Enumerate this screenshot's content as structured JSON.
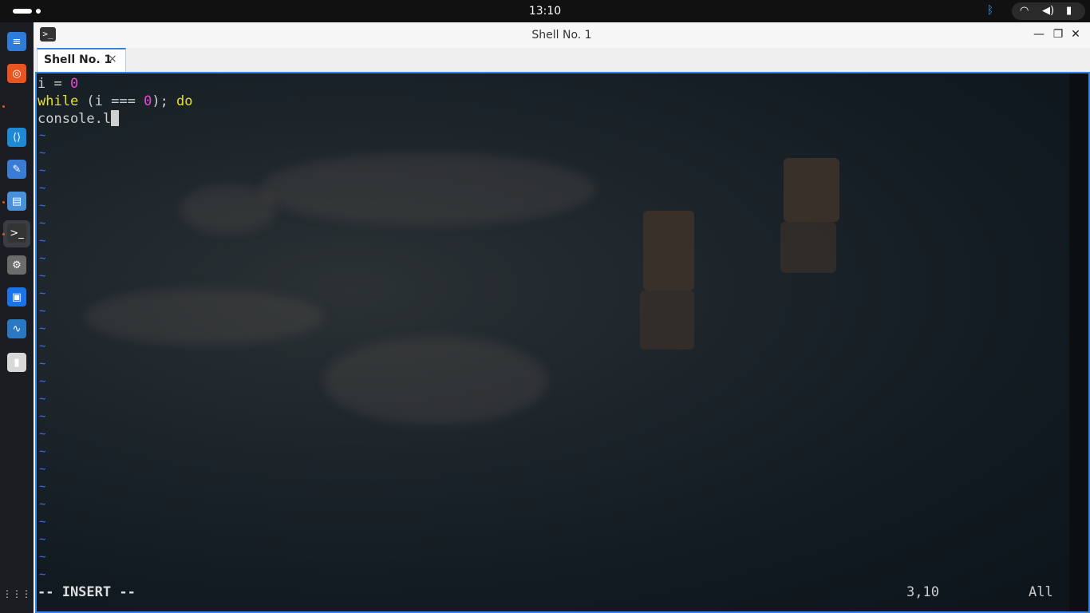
{
  "topbar": {
    "time": "13:10"
  },
  "window": {
    "title": "Shell No. 1",
    "tab_label": "Shell No. 1",
    "close_tab": "×"
  },
  "editor": {
    "lines": [
      {
        "segments": [
          {
            "text": "i = ",
            "color": "#cfcfcf"
          },
          {
            "text": "0",
            "color": "#e44ad6"
          }
        ]
      },
      {
        "segments": [
          {
            "text": "while",
            "color": "#e7e12f"
          },
          {
            "text": " (i === ",
            "color": "#cfcfcf"
          },
          {
            "text": "0",
            "color": "#e44ad6"
          },
          {
            "text": "); ",
            "color": "#cfcfcf"
          },
          {
            "text": "do",
            "color": "#e7e12f"
          }
        ]
      },
      {
        "segments": [
          {
            "text": "console.l",
            "color": "#cfcfcf"
          }
        ]
      }
    ],
    "tilde": "~",
    "tilde_count": 26,
    "mode": "-- INSERT --",
    "cursor_position": "3,10",
    "scroll_state": "All"
  },
  "dock": {
    "apps": [
      {
        "name": "libreoffice-writer-icon",
        "color": "#2f7bd9",
        "glyph": "≡"
      },
      {
        "name": "help-lifebuoy-icon",
        "color": "#e95420",
        "glyph": "◎"
      },
      {
        "name": "vscode-icon",
        "color": "#1e8ad6",
        "glyph": "⟨⟩"
      },
      {
        "name": "text-editor-icon",
        "color": "#3a7bd5",
        "glyph": "✎"
      },
      {
        "name": "files-icon",
        "color": "#4a90d9",
        "glyph": "▤"
      },
      {
        "name": "terminal-icon",
        "color": "#333333",
        "glyph": ">_"
      },
      {
        "name": "settings-gear-icon",
        "color": "#6b6b6b",
        "glyph": "⚙"
      },
      {
        "name": "software-store-icon",
        "color": "#1a73e8",
        "glyph": "▣"
      },
      {
        "name": "system-monitor-icon",
        "color": "#2b78c2",
        "glyph": "∿"
      },
      {
        "name": "trash-icon",
        "color": "#d8d8d8",
        "glyph": "▮"
      }
    ],
    "grid_icon": "⋮⋮⋮"
  }
}
